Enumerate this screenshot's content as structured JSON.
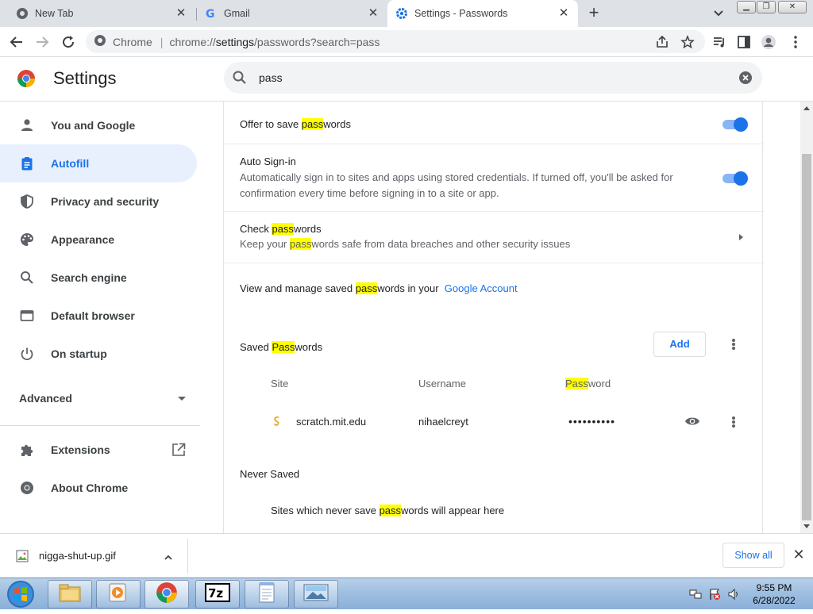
{
  "tabs": [
    {
      "title": "New Tab",
      "icon": "chrome-icon"
    },
    {
      "title": "Gmail",
      "icon": "google-icon"
    },
    {
      "title": "Settings - Passwords",
      "icon": "settings-gear-icon",
      "active": true
    }
  ],
  "omnibox": {
    "site_chip": "Chrome",
    "url_prefix": "chrome://",
    "url_main": "settings",
    "url_rest": "/passwords?search=pass"
  },
  "header": {
    "title": "Settings",
    "search_value": "pass"
  },
  "sidebar": {
    "items": [
      {
        "label": "You and Google",
        "icon": "person-icon"
      },
      {
        "label": "Autofill",
        "icon": "clipboard-icon",
        "selected": true
      },
      {
        "label": "Privacy and security",
        "icon": "shield-icon"
      },
      {
        "label": "Appearance",
        "icon": "palette-icon"
      },
      {
        "label": "Search engine",
        "icon": "search-icon"
      },
      {
        "label": "Default browser",
        "icon": "browser-icon"
      },
      {
        "label": "On startup",
        "icon": "power-icon"
      }
    ],
    "advanced": "Advanced",
    "extensions": "Extensions",
    "about": "About Chrome"
  },
  "main": {
    "offer_save": {
      "pre": "Offer to save ",
      "hl": "pass",
      "post": "words",
      "enabled": true
    },
    "auto_signin": {
      "title": "Auto Sign-in",
      "sub": "Automatically sign in to sites and apps using stored credentials. If turned off, you'll be asked for confirmation every time before signing in to a site or app.",
      "enabled": true
    },
    "check_passwords": {
      "pre": "Check ",
      "hl": "pass",
      "post": "words",
      "sub_pre": "Keep your ",
      "sub_hl": "pass",
      "sub_post": "words safe from data breaches and other security issues"
    },
    "manage": {
      "pre": "View and manage saved ",
      "hl": "pass",
      "post": "words in your",
      "link": "Google Account"
    },
    "saved_passwords": {
      "pre": "Saved ",
      "hl": "Pass",
      "post": "words",
      "add_label": "Add"
    },
    "columns": {
      "site": "Site",
      "username": "Username",
      "password_hl": "Pass",
      "password_post": "word"
    },
    "entries": [
      {
        "site": "scratch.mit.edu",
        "username": "nihaelcreyt",
        "password": "••••••••••"
      }
    ],
    "never_saved": {
      "title": "Never Saved",
      "pre": "Sites which never save ",
      "hl": "pass",
      "post": "words will appear here"
    }
  },
  "download": {
    "filename": "nigga-shut-up.gif",
    "show_all": "Show all"
  },
  "taskbar": {
    "time": "9:55 PM",
    "date": "6/28/2022",
    "apps": [
      "file-explorer-icon",
      "media-player-icon",
      "chrome-icon",
      "7zip-icon",
      "notepad-icon",
      "picture-viewer-icon"
    ]
  },
  "colors": {
    "accent": "#1a73e8",
    "highlight": "#ffff00",
    "selected_bg": "#e8f0fe"
  }
}
